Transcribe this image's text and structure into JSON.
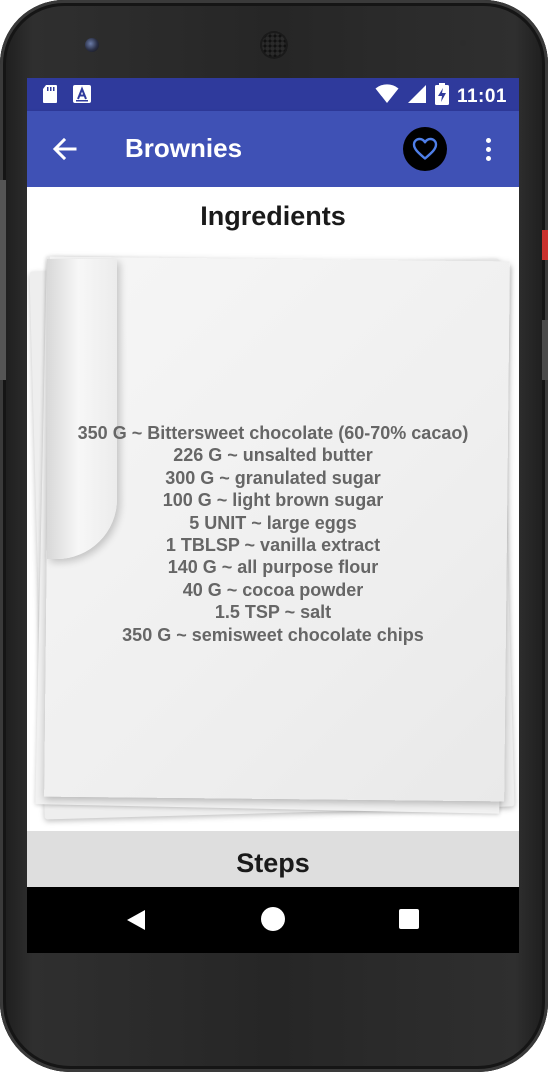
{
  "status_bar": {
    "time": "11:01",
    "icons_left": [
      "sd-card-icon",
      "app-notification-icon"
    ],
    "icons_right": [
      "wifi-icon",
      "signal-icon",
      "battery-charging-icon"
    ]
  },
  "app_bar": {
    "title": "Brownies",
    "back_icon": "arrow-left-icon",
    "favorite_icon": "heart-outline-icon",
    "more_icon": "more-vert-icon"
  },
  "ingredients": {
    "heading": "Ingredients",
    "items": [
      "350 G ~ Bittersweet chocolate (60-70% cacao)",
      "226 G ~ unsalted butter",
      "300 G ~ granulated sugar",
      "100 G ~ light brown sugar",
      "5 UNIT ~ large eggs",
      "1 TBLSP ~ vanilla extract",
      "140 G ~ all purpose flour",
      "40 G ~ cocoa powder",
      "1.5 TSP ~ salt",
      "350 G ~ semisweet chocolate chips"
    ]
  },
  "steps": {
    "label": "Steps"
  },
  "colors": {
    "status_bar": "#2f3a9c",
    "app_bar": "#3f51b5",
    "ingredient_text": "#666666",
    "steps_bar": "#dedede"
  }
}
